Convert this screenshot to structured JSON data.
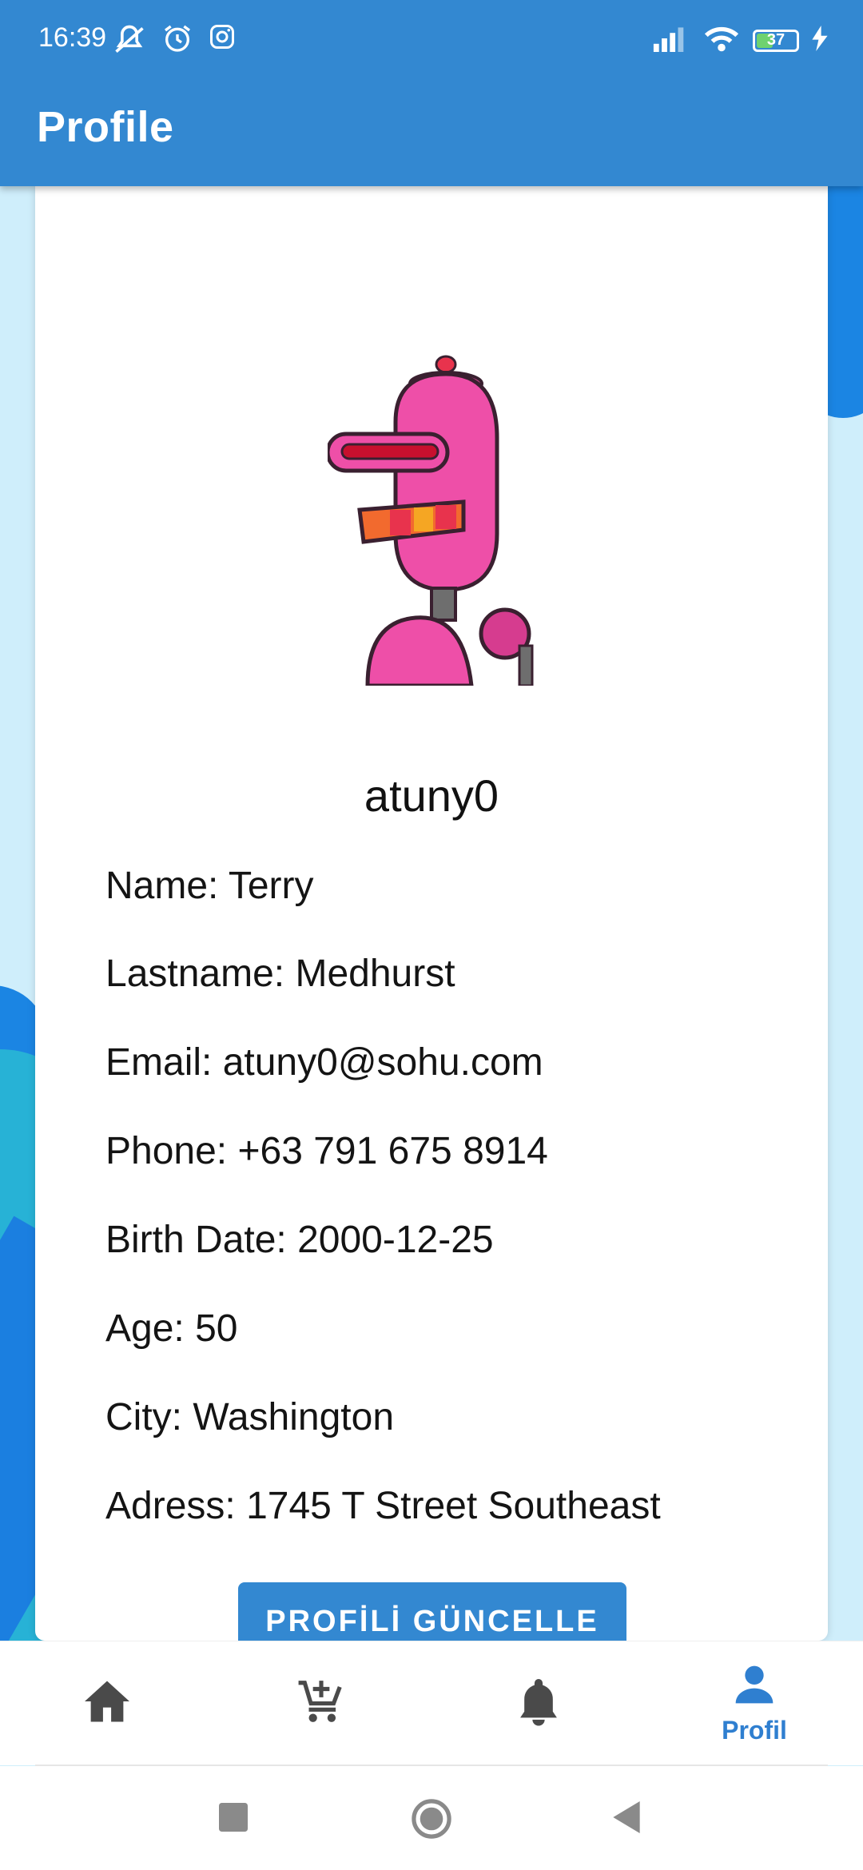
{
  "status": {
    "time": "16:39",
    "battery": "37",
    "icons": [
      "mute-icon",
      "alarm-icon",
      "instagram-icon",
      "signal-icon",
      "wifi-icon",
      "battery-icon",
      "charging-icon"
    ]
  },
  "appbar": {
    "title": "Profile"
  },
  "profile": {
    "username": "atuny0",
    "fields": {
      "name": "Name: Terry",
      "lastname": "Lastname: Medhurst",
      "email": "Email: atuny0@sohu.com",
      "phone": "Phone: +63 791 675 8914",
      "birth_date": "Birth Date: 2000-12-25",
      "age": "Age: 50",
      "city": "City: Washington",
      "address": "Adress: 1745 T Street Southeast"
    },
    "update_button": "PROFİLİ GÜNCELLE"
  },
  "bottom_nav": {
    "items": [
      {
        "icon": "home-icon"
      },
      {
        "icon": "add-to-cart-icon"
      },
      {
        "icon": "bell-icon"
      },
      {
        "icon": "person-icon",
        "label": "Profil",
        "active": true
      }
    ]
  },
  "colors": {
    "primary": "#3388d1",
    "active_nav": "#2f7fd0"
  }
}
